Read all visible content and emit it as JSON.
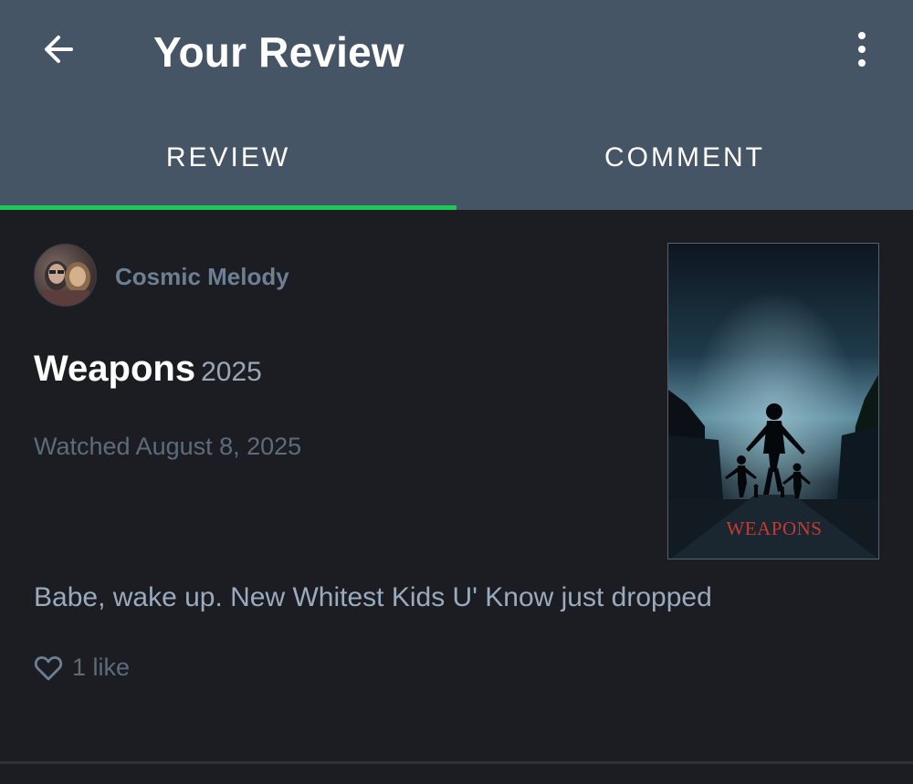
{
  "header": {
    "title": "Your Review",
    "back_icon": "arrow-left-icon",
    "more_icon": "more-vertical-icon"
  },
  "tabs": [
    {
      "label": "REVIEW",
      "active": true
    },
    {
      "label": "COMMENT",
      "active": false
    }
  ],
  "review": {
    "username": "Cosmic Melody",
    "film_title": "Weapons",
    "film_year": "2025",
    "watched": "Watched August 8, 2025",
    "poster_title": "WEAPONS",
    "text": "Babe, wake up. New Whitest Kids U' Know just dropped",
    "likes": "1 like"
  },
  "colors": {
    "header_bg": "#465566",
    "body_bg": "#1b1d22",
    "accent": "#1ec95c",
    "username": "#6d7f93"
  }
}
